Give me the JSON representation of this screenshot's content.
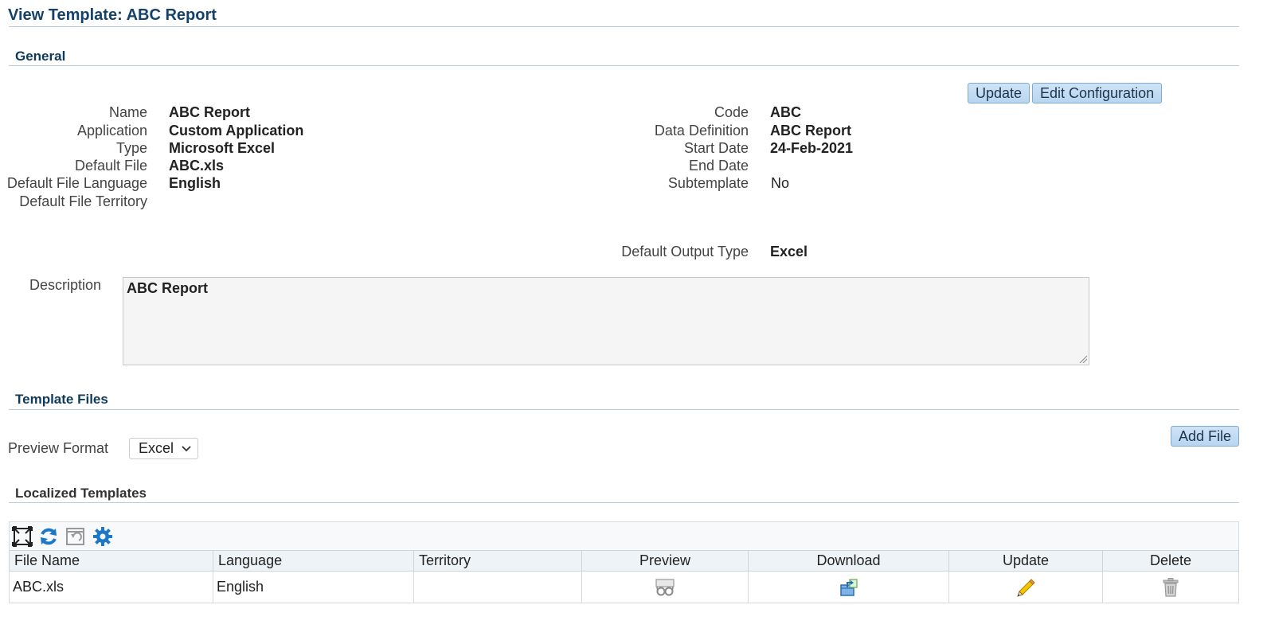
{
  "page": {
    "title": "View Template: ABC Report"
  },
  "general": {
    "section_title": "General",
    "buttons": {
      "update": "Update",
      "edit_configuration": "Edit Configuration"
    },
    "left_fields": [
      {
        "label": "Name",
        "value": "ABC Report"
      },
      {
        "label": "Application",
        "value": "Custom Application"
      },
      {
        "label": "Type",
        "value": "Microsoft Excel"
      },
      {
        "label": "Default File",
        "value": "ABC.xls"
      },
      {
        "label": "Default File Language",
        "value": "English"
      },
      {
        "label": "Default File Territory",
        "value": ""
      }
    ],
    "right_fields": [
      {
        "label": "Code",
        "value": "ABC"
      },
      {
        "label": "Data Definition",
        "value": "ABC Report"
      },
      {
        "label": "Start Date",
        "value": "24-Feb-2021"
      },
      {
        "label": "End Date",
        "value": ""
      },
      {
        "label": "Subtemplate",
        "value": "No"
      }
    ],
    "output_type": {
      "label": "Default Output Type",
      "value": "Excel"
    },
    "description": {
      "label": "Description",
      "value": "ABC Report"
    }
  },
  "template_files": {
    "section_title": "Template Files",
    "preview_format": {
      "label": "Preview Format",
      "selected": "Excel"
    },
    "add_file_button": "Add File"
  },
  "localized": {
    "section_title": "Localized Templates",
    "toolbar_icons": [
      "detach-icon",
      "refresh-icon",
      "restore-icon",
      "settings-gear-icon"
    ],
    "columns": [
      "File Name",
      "Language",
      "Territory",
      "Preview",
      "Download",
      "Update",
      "Delete"
    ],
    "rows": [
      {
        "file_name": "ABC.xls",
        "language": "English",
        "territory": ""
      }
    ]
  }
}
